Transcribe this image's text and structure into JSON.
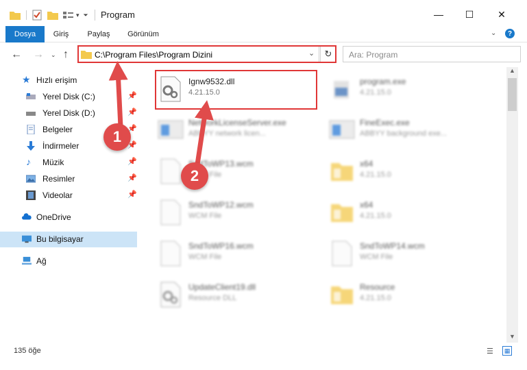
{
  "window": {
    "title": "Program",
    "minimize": "—",
    "maximize": "☐",
    "close": "✕"
  },
  "ribbon": {
    "tabs": [
      {
        "label": "Dosya"
      },
      {
        "label": "Giriş"
      },
      {
        "label": "Paylaş"
      },
      {
        "label": "Görünüm"
      }
    ],
    "help": "?"
  },
  "address": {
    "path": "C:\\Program Files\\Program Dizini",
    "search_placeholder": "Ara: Program"
  },
  "nav_pane": {
    "quick_access": "Hızlı erişim",
    "items": [
      {
        "label": "Yerel Disk (C:)"
      },
      {
        "label": "Yerel Disk (D:)"
      },
      {
        "label": "Belgeler"
      },
      {
        "label": "İndirmeler"
      },
      {
        "label": "Müzik"
      },
      {
        "label": "Resimler"
      },
      {
        "label": "Videolar"
      }
    ],
    "onedrive": "OneDrive",
    "this_pc": "Bu bilgisayar",
    "network": "Ağ"
  },
  "files": [
    {
      "name": "Ignw9532.dll",
      "sub": "4.21.15.0",
      "icon": "dll-gear-icon"
    },
    {
      "name": "program.exe",
      "sub": "4.21.15.0",
      "icon": "exe-icon"
    },
    {
      "name": "NetworkLicenseServer.exe",
      "sub": "ABBYY network licen...",
      "icon": "exe-window-icon"
    },
    {
      "name": "FineExec.exe",
      "sub": "ABBYY background exe...",
      "icon": "exe-window-icon"
    },
    {
      "name": "SndToWP13.wcm",
      "sub": "WCM File",
      "icon": "file-icon"
    },
    {
      "name": "x64",
      "sub": "4.21.15.0",
      "icon": "folder-icon"
    },
    {
      "name": "SndToWP12.wcm",
      "sub": "WCM File",
      "icon": "file-icon"
    },
    {
      "name": "x64",
      "sub": "4.21.15.0",
      "icon": "folder-icon"
    },
    {
      "name": "SndToWP16.wcm",
      "sub": "WCM File",
      "icon": "file-icon"
    },
    {
      "name": "SndToWP14.wcm",
      "sub": "WCM File",
      "icon": "file-icon"
    },
    {
      "name": "UpdateClient19.dll",
      "sub": "Resource DLL",
      "icon": "dll-gear-icon"
    },
    {
      "name": "Resource",
      "sub": "4.21.15.0",
      "icon": "folder-icon"
    }
  ],
  "status": {
    "count": "135 öğe"
  },
  "annotations": {
    "step1": "1",
    "step2": "2",
    "color": "#e03636"
  }
}
